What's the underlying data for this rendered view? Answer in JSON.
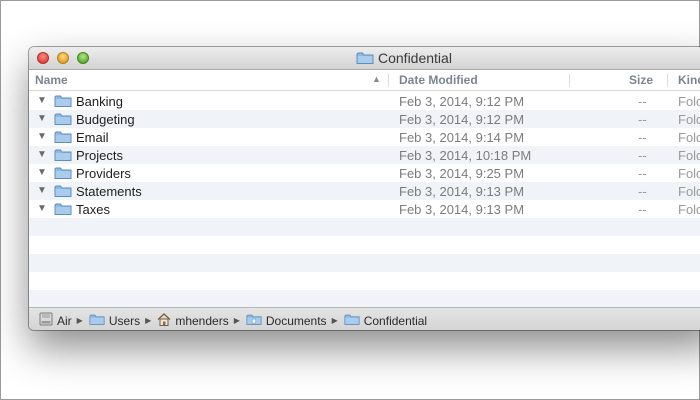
{
  "window": {
    "title": "Confidential"
  },
  "columns": {
    "name": "Name",
    "date_modified": "Date Modified",
    "size": "Size",
    "kind": "Kind"
  },
  "rows": [
    {
      "name": "Banking",
      "date": "Feb 3, 2014, 9:12 PM",
      "size": "--",
      "kind": "Folder"
    },
    {
      "name": "Budgeting",
      "date": "Feb 3, 2014, 9:12 PM",
      "size": "--",
      "kind": "Folder"
    },
    {
      "name": "Email",
      "date": "Feb 3, 2014, 9:14 PM",
      "size": "--",
      "kind": "Folder"
    },
    {
      "name": "Projects",
      "date": "Feb 3, 2014, 10:18 PM",
      "size": "--",
      "kind": "Folder"
    },
    {
      "name": "Providers",
      "date": "Feb 3, 2014, 9:25 PM",
      "size": "--",
      "kind": "Folder"
    },
    {
      "name": "Statements",
      "date": "Feb 3, 2014, 9:13 PM",
      "size": "--",
      "kind": "Folder"
    },
    {
      "name": "Taxes",
      "date": "Feb 3, 2014, 9:13 PM",
      "size": "--",
      "kind": "Folder"
    }
  ],
  "path_bar": [
    {
      "label": "Air",
      "icon": "drive-icon"
    },
    {
      "label": "Users",
      "icon": "folder-icon"
    },
    {
      "label": "mhenders",
      "icon": "home-icon"
    },
    {
      "label": "Documents",
      "icon": "documents-folder-icon"
    },
    {
      "label": "Confidential",
      "icon": "folder-icon"
    }
  ],
  "colors": {
    "row_alt": "#f0f3f8",
    "folder": "#8fb9e1",
    "header_text": "#7b8592"
  }
}
